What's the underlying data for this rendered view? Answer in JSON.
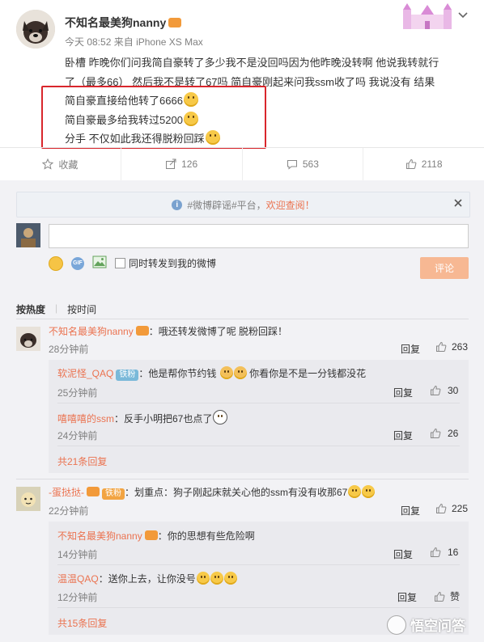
{
  "post": {
    "author": "不知名最美狗nanny",
    "time": "今天 08:52",
    "source_prefix": "来自",
    "source": "iPhone XS Max",
    "text_line1": "卧槽 昨晚你们问我简自豪转了多少我不是没回吗因为他昨晚没转啊 他说我转就行",
    "text_line2": "了（最多66） 然后我不是转了67吗 简自豪刚起来问我ssm收了吗 我说没有 结果",
    "text_line3": "简自豪直接给他转了6666",
    "text_line4": "简自豪最多给我转过5200",
    "text_line5": "分手 不仅如此我还得脱粉回踩"
  },
  "actions": {
    "favorite": "收藏",
    "repost": "126",
    "comment": "563",
    "like": "2118"
  },
  "notice": {
    "prefix": "#微博辟谣#平台，",
    "link": "欢迎查阅！"
  },
  "composer": {
    "sync_label": "同时转发到我的微博",
    "submit": "评论"
  },
  "sort": {
    "hot": "按热度",
    "time": "按时间"
  },
  "reply_label": "回复",
  "comments": [
    {
      "user": "不知名最美狗nanny",
      "text": "：哦还转发微博了呢 脱粉回踩！",
      "time": "28分钟前",
      "likes": "263",
      "replies": [
        {
          "user": "软泥怪_QAQ",
          "badge": "铁粉",
          "text": "：他是帮你节约钱",
          "text2": "你看你是不是一分钱都没花",
          "time": "25分钟前",
          "likes": "30"
        },
        {
          "user": "嘻嘻嘻的ssm",
          "text": "：反手小明把67也点了",
          "time": "24分钟前",
          "likes": "26"
        }
      ],
      "more": "共21条回复"
    },
    {
      "user": "-蛋挞挞-",
      "badge": "铁粉",
      "text": "：划重点：狗子刚起床就关心他的ssm有没有收那67",
      "time": "22分钟前",
      "likes": "225",
      "replies": [
        {
          "user": "不知名最美狗nanny",
          "text": "：你的思想有些危险啊",
          "time": "14分钟前",
          "likes": "16"
        },
        {
          "user": "温温QAQ",
          "text": "：送你上去，让你没号",
          "time": "12分钟前",
          "likes": "赞"
        }
      ],
      "more": "共15条回复"
    }
  ],
  "watermark": "悟空问答",
  "colors": {
    "accent": "#eb7350",
    "highlight_box": "#d9262c",
    "panel": "#f2f2f5"
  }
}
